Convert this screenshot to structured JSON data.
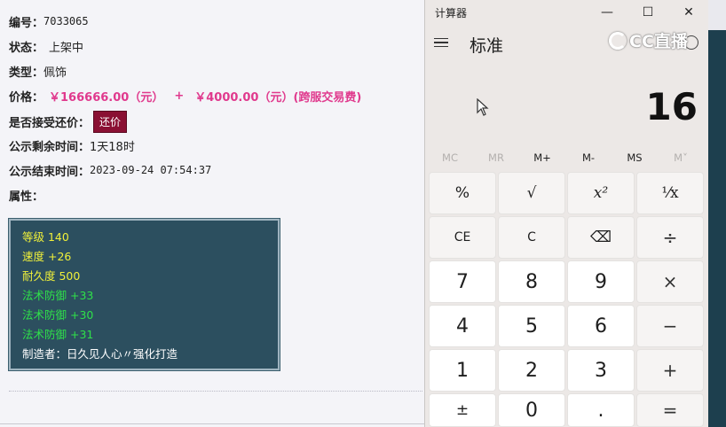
{
  "item": {
    "id_label": "编号：",
    "id_value": "7033065",
    "status_label": "状态：",
    "status_value": "上架中",
    "type_label": "类型：",
    "type_value": "佩饰",
    "price_label": "价格：",
    "price_value": "￥166666.00（元）",
    "price_plus": "+",
    "fee_value": "￥4000.00（元）(跨服交易费)",
    "counter_label": "是否接受还价：",
    "counter_button": "还价",
    "remaining_label": "公示剩余时间：",
    "remaining_value": "1天18时",
    "end_label": "公示结束时间：",
    "end_value": "2023-09-24 07:54:37",
    "attrs_label": "属性："
  },
  "properties": [
    {
      "text": "等级 140",
      "color": "#f0f03a"
    },
    {
      "text": "速度 +26",
      "color": "#f0f03a"
    },
    {
      "text": "耐久度 500",
      "color": "#f0f03a"
    },
    {
      "text": "法术防御 +33",
      "color": "#2fe04a"
    },
    {
      "text": "法术防御 +30",
      "color": "#2fe04a"
    },
    {
      "text": "法术防御 +31",
      "color": "#2fe04a"
    },
    {
      "text": "制造者：日久见人心〃强化打造",
      "color": "#ffffff"
    }
  ],
  "calculator": {
    "title": "计算器",
    "mode": "标准",
    "display": "16",
    "window_buttons": {
      "minimize": "—",
      "maximize": "☐",
      "close": "✕"
    },
    "memory": [
      "MC",
      "MR",
      "M+",
      "M-",
      "MS",
      "M˅"
    ],
    "keys": [
      [
        "%",
        "√",
        "x²",
        "¹⁄x"
      ],
      [
        "CE",
        "C",
        "⌫",
        "÷"
      ],
      [
        "7",
        "8",
        "9",
        "×"
      ],
      [
        "4",
        "5",
        "6",
        "−"
      ],
      [
        "1",
        "2",
        "3",
        "+"
      ],
      [
        "±",
        "0",
        ".",
        "="
      ]
    ]
  },
  "watermark": {
    "text": "CC直播"
  }
}
